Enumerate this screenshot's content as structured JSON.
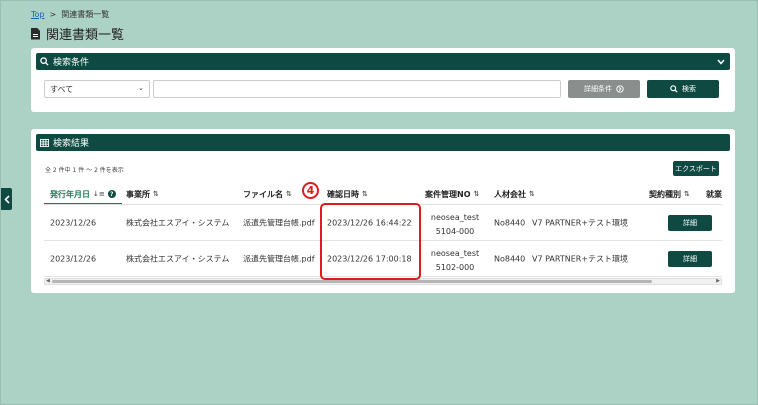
{
  "breadcrumb": {
    "home": "Top",
    "separator": ">",
    "current": "関連書類一覧"
  },
  "page_title": "関連書類一覧",
  "search_panel": {
    "title": "検索条件",
    "select_value": "すべて",
    "input_value": "",
    "detail_button": "詳細条件",
    "search_button": "検索"
  },
  "results_panel": {
    "title": "検索結果",
    "count_text": "全 2 件中 1 件 ～ 2 件を表示",
    "export_button": "エクスポート",
    "columns": [
      "発行年月日",
      "事業所",
      "ファイル名",
      "確認日時",
      "案件管理NO",
      "人材会社",
      "契約種別",
      "就業"
    ],
    "rows": [
      {
        "date": "2023/12/26",
        "office": "株式会社エスアイ・システム",
        "file": "派遣先管理台帳.pdf",
        "confirmed": "2023/12/26 16:44:22",
        "case_line1": "neosea_test",
        "case_line2": "5104-000",
        "agency_no": "No8440",
        "agency_name": "V7 PARTNER+テスト環境",
        "detail": "詳細"
      },
      {
        "date": "2023/12/26",
        "office": "株式会社エスアイ・システム",
        "file": "派遣先管理台帳.pdf",
        "confirmed": "2023/12/26 17:00:18",
        "case_line1": "neosea_test",
        "case_line2": "5102-000",
        "agency_no": "No8440",
        "agency_name": "V7 PARTNER+テスト環境",
        "detail": "詳細"
      }
    ]
  },
  "annotation": {
    "badge": "4",
    "color": "#e01b1b"
  },
  "colors": {
    "accent": "#0e4a41",
    "background": "#acd2c6",
    "active_column": "#1d7a55"
  }
}
